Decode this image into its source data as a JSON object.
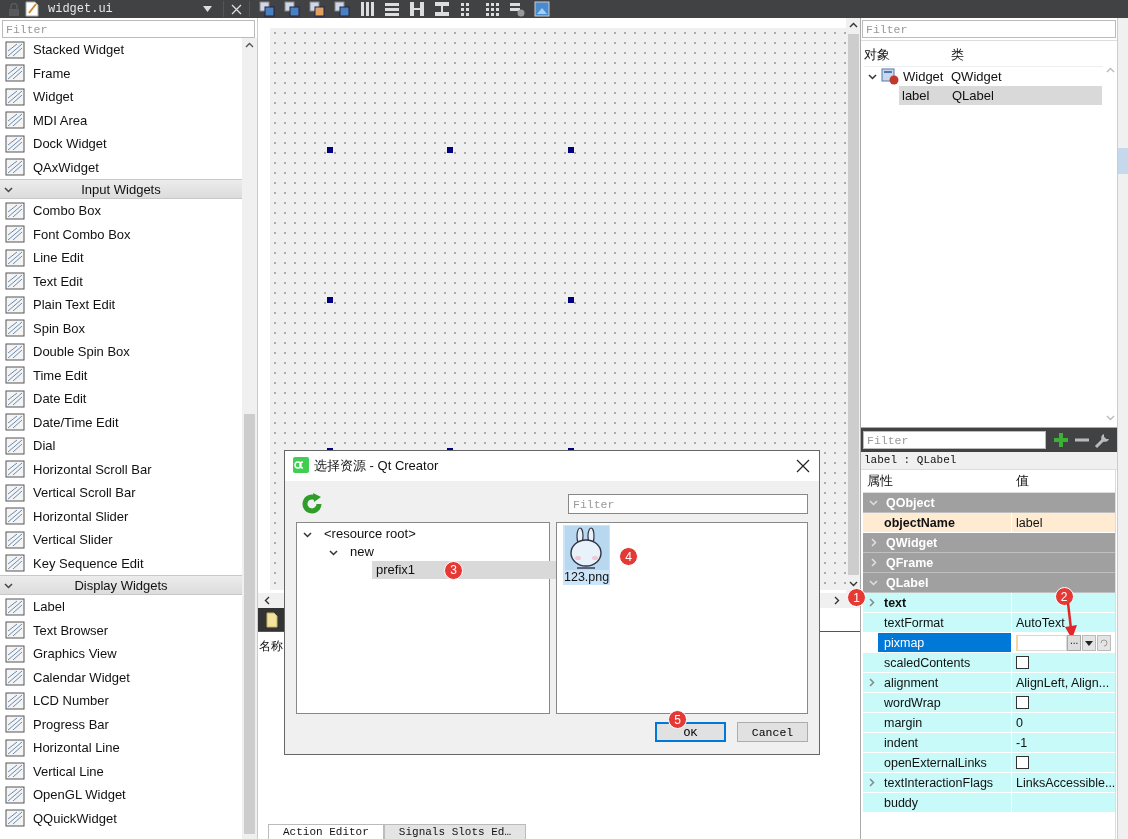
{
  "editor_tab": {
    "file_name": "widget.ui"
  },
  "widget_box": {
    "filter": {
      "placeholder": "Filter"
    },
    "entries": [
      {
        "kind": "item",
        "label": "Stacked Widget"
      },
      {
        "kind": "item",
        "label": "Frame"
      },
      {
        "kind": "item",
        "label": "Widget"
      },
      {
        "kind": "item",
        "label": "MDI Area"
      },
      {
        "kind": "item",
        "label": "Dock Widget"
      },
      {
        "kind": "item",
        "label": "QAxWidget"
      },
      {
        "kind": "category",
        "label": "Input Widgets",
        "expanded": true
      },
      {
        "kind": "item",
        "label": "Combo Box"
      },
      {
        "kind": "item",
        "label": "Font Combo Box"
      },
      {
        "kind": "item",
        "label": "Line Edit"
      },
      {
        "kind": "item",
        "label": "Text Edit"
      },
      {
        "kind": "item",
        "label": "Plain Text Edit"
      },
      {
        "kind": "item",
        "label": "Spin Box"
      },
      {
        "kind": "item",
        "label": "Double Spin Box"
      },
      {
        "kind": "item",
        "label": "Time Edit"
      },
      {
        "kind": "item",
        "label": "Date Edit"
      },
      {
        "kind": "item",
        "label": "Date/Time Edit"
      },
      {
        "kind": "item",
        "label": "Dial"
      },
      {
        "kind": "item",
        "label": "Horizontal Scroll Bar"
      },
      {
        "kind": "item",
        "label": "Vertical Scroll Bar"
      },
      {
        "kind": "item",
        "label": "Horizontal Slider"
      },
      {
        "kind": "item",
        "label": "Vertical Slider"
      },
      {
        "kind": "item",
        "label": "Key Sequence Edit"
      },
      {
        "kind": "category",
        "label": "Display Widgets",
        "expanded": true
      },
      {
        "kind": "item",
        "label": "Label"
      },
      {
        "kind": "item",
        "label": "Text Browser"
      },
      {
        "kind": "item",
        "label": "Graphics View"
      },
      {
        "kind": "item",
        "label": "Calendar Widget"
      },
      {
        "kind": "item",
        "label": "LCD Number"
      },
      {
        "kind": "item",
        "label": "Progress Bar"
      },
      {
        "kind": "item",
        "label": "Horizontal Line"
      },
      {
        "kind": "item",
        "label": "Vertical Line"
      },
      {
        "kind": "item",
        "label": "OpenGL Widget"
      },
      {
        "kind": "item",
        "label": "QQuickWidget"
      }
    ]
  },
  "form_editor": {
    "scroll_callout": "1",
    "name_header": "名称",
    "bottom_tabs": [
      {
        "label": "Action Editor",
        "selected": true
      },
      {
        "label": "Signals Slots Ed…",
        "selected": false
      }
    ]
  },
  "object_inspector": {
    "filter": {
      "placeholder": "Filter"
    },
    "columns": [
      "对象",
      "类"
    ],
    "rows": [
      {
        "object": "Widget",
        "class": "QWidget",
        "expanded": true,
        "selected": false,
        "children": [
          {
            "object": "label",
            "class": "QLabel",
            "selected": true
          }
        ]
      }
    ]
  },
  "property_editor": {
    "filter": {
      "placeholder": "Filter"
    },
    "caption": "label : QLabel",
    "columns": [
      "属性",
      "值"
    ],
    "rows": [
      {
        "kind": "group",
        "label": "QObject",
        "expanded": true
      },
      {
        "kind": "text",
        "label": "objectName",
        "value": "label",
        "modified": true,
        "selected": false,
        "color": "#feebd2"
      },
      {
        "kind": "group",
        "label": "QWidget",
        "expanded": false
      },
      {
        "kind": "group",
        "label": "QFrame",
        "expanded": false
      },
      {
        "kind": "group",
        "label": "QLabel",
        "expanded": true
      },
      {
        "kind": "text",
        "label": "text",
        "value": "",
        "modified": true,
        "selected": false,
        "expanded": false,
        "callout": "2",
        "color": "#c8fafa"
      },
      {
        "kind": "text",
        "label": "textFormat",
        "value": "AutoText",
        "modified": false,
        "selected": false,
        "color": "#c8fafa"
      },
      {
        "kind": "pixmap",
        "label": "pixmap",
        "modified": false,
        "selected": true,
        "button": "..."
      },
      {
        "kind": "checkbox",
        "label": "scaledContents",
        "checked": false,
        "modified": false,
        "selected": false,
        "color": "#c8fafa"
      },
      {
        "kind": "text",
        "label": "alignment",
        "value": "AlignLeft, Align...",
        "modified": false,
        "selected": false,
        "expanded": false,
        "color": "#c8fafa"
      },
      {
        "kind": "checkbox",
        "label": "wordWrap",
        "checked": false,
        "modified": false,
        "selected": false,
        "color": "#c8fafa"
      },
      {
        "kind": "text",
        "label": "margin",
        "value": "0",
        "modified": false,
        "selected": false,
        "color": "#c8fafa"
      },
      {
        "kind": "text",
        "label": "indent",
        "value": "-1",
        "modified": false,
        "selected": false,
        "color": "#c8fafa"
      },
      {
        "kind": "checkbox",
        "label": "openExternalLinks",
        "checked": false,
        "modified": false,
        "selected": false,
        "color": "#c8fafa"
      },
      {
        "kind": "text",
        "label": "textInteractionFlags",
        "value": "LinksAccessible...",
        "modified": false,
        "selected": false,
        "expanded": false,
        "color": "#c8fafa"
      },
      {
        "kind": "text",
        "label": "buddy",
        "value": "",
        "modified": false,
        "selected": false,
        "color": "#c8fafa"
      }
    ]
  },
  "dialog": {
    "title": "选择资源 - Qt Creator",
    "filter": {
      "placeholder": "Filter"
    },
    "tree": [
      {
        "label": "<resource root>",
        "expanded": true,
        "selected": false,
        "children": [
          {
            "label": "new",
            "expanded": true,
            "selected": false,
            "children": [
              {
                "label": "prefix1",
                "selected": true,
                "callout": "3"
              }
            ]
          }
        ]
      }
    ],
    "files": [
      {
        "name": "123.png",
        "kind": "picture",
        "selected": true,
        "callout": "4"
      }
    ],
    "buttons": [
      {
        "label": "OK",
        "default": true,
        "callout": "5"
      },
      {
        "label": "Cancel",
        "default": false
      }
    ]
  }
}
